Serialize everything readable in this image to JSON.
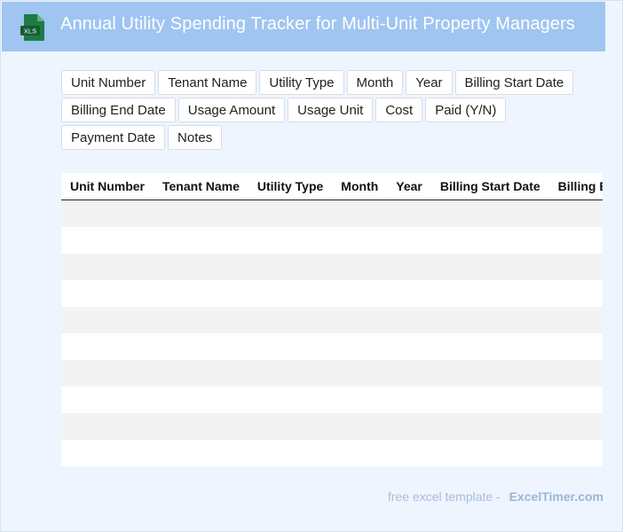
{
  "header": {
    "title": "Annual Utility Spending Tracker for Multi-Unit Property Managers",
    "icon_label": "XLS",
    "icon_color": "#1e7a45",
    "background": "#9fc5f0"
  },
  "fields": [
    "Unit Number",
    "Tenant Name",
    "Utility Type",
    "Month",
    "Year",
    "Billing Start Date",
    "Billing End Date",
    "Usage Amount",
    "Usage Unit",
    "Cost",
    "Paid (Y/N)",
    "Payment Date",
    "Notes"
  ],
  "table": {
    "columns": [
      "Unit Number",
      "Tenant Name",
      "Utility Type",
      "Month",
      "Year",
      "Billing Start Date",
      "Billing End Date",
      "Usage Amount",
      "Usage Unit",
      "Cost",
      "Paid (Y/N)",
      "Payment Date",
      "Notes"
    ],
    "empty_rows": 10
  },
  "footer": {
    "free_text": "free excel template -",
    "brand": "ExcelTimer.com"
  }
}
